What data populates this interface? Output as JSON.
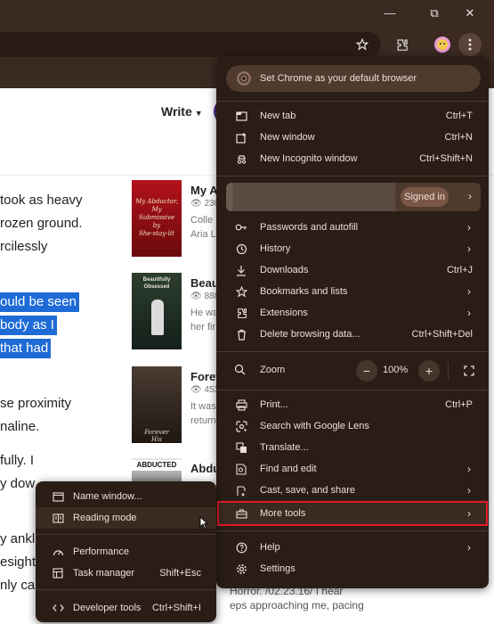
{
  "window": {
    "minimize": "—",
    "restore": "⧉",
    "close": "✕"
  },
  "toolbar": {
    "icons": [
      "star-icon",
      "extensions-icon",
      "profile-avatar-icon",
      "kebab-menu-icon"
    ]
  },
  "page": {
    "write_label": "Write",
    "story_lines": [
      "took as heavy",
      "rozen ground.",
      "rcilessly",
      "ould be seen",
      "body as I",
      "that had",
      "se proximity",
      "naline.",
      "fully. I",
      "y dow",
      "y ankl",
      "esight",
      "nly cau"
    ],
    "cards": [
      {
        "title": "My Ab",
        "meta": "230",
        "desc": [
          "Colle",
          "Aria L"
        ],
        "cover_text": [
          "My Abductor,",
          "My",
          "Submissive",
          "by",
          "She-stay-lit"
        ]
      },
      {
        "title": "Beaut",
        "meta": "888",
        "desc": [
          "He wa",
          "her fir"
        ],
        "cover_text": [
          "Beautifully",
          "Obsessed"
        ]
      },
      {
        "title": "Forev",
        "meta": "453",
        "desc": [
          "It was",
          "return"
        ],
        "cover_text": [
          "Forever",
          "His"
        ]
      },
      {
        "title": "Abdu",
        "meta": "",
        "desc": [],
        "cover_text": [
          "ABDUCTED"
        ]
      }
    ],
    "bottom_lines": [
      "Horror. /02.23.16/ I hear",
      "eps approaching me, pacing"
    ]
  },
  "menu": {
    "default_browser": "Set Chrome as your default browser",
    "new_tab": {
      "label": "New tab",
      "shortcut": "Ctrl+T"
    },
    "new_window": {
      "label": "New window",
      "shortcut": "Ctrl+N"
    },
    "incognito": {
      "label": "New Incognito window",
      "shortcut": "Ctrl+Shift+N"
    },
    "signed_in": "Signed in",
    "passwords": "Passwords and autofill",
    "history": "History",
    "downloads": {
      "label": "Downloads",
      "shortcut": "Ctrl+J"
    },
    "bookmarks": "Bookmarks and lists",
    "extensions": "Extensions",
    "delete_data": {
      "label": "Delete browsing data...",
      "shortcut": "Ctrl+Shift+Del"
    },
    "zoom": {
      "label": "Zoom",
      "value": "100%",
      "minus": "−",
      "plus": "+"
    },
    "print": {
      "label": "Print...",
      "shortcut": "Ctrl+P"
    },
    "lens": "Search with Google Lens",
    "translate": "Translate...",
    "find_edit": "Find and edit",
    "cast_save": "Cast, save, and share",
    "more_tools": "More tools",
    "help": "Help",
    "settings": "Settings"
  },
  "submenu": {
    "name_window": "Name window...",
    "reading_mode": "Reading mode",
    "performance": "Performance",
    "task_manager": {
      "label": "Task manager",
      "shortcut": "Shift+Esc"
    },
    "developer_tools": {
      "label": "Developer tools",
      "shortcut": "Ctrl+Shift+I"
    }
  },
  "colors": {
    "chrome_bg": "#3a2a22",
    "menu_bg": "#2a1d16",
    "highlight_border": "#e11b2a",
    "text_selection": "#1e6bd6"
  }
}
